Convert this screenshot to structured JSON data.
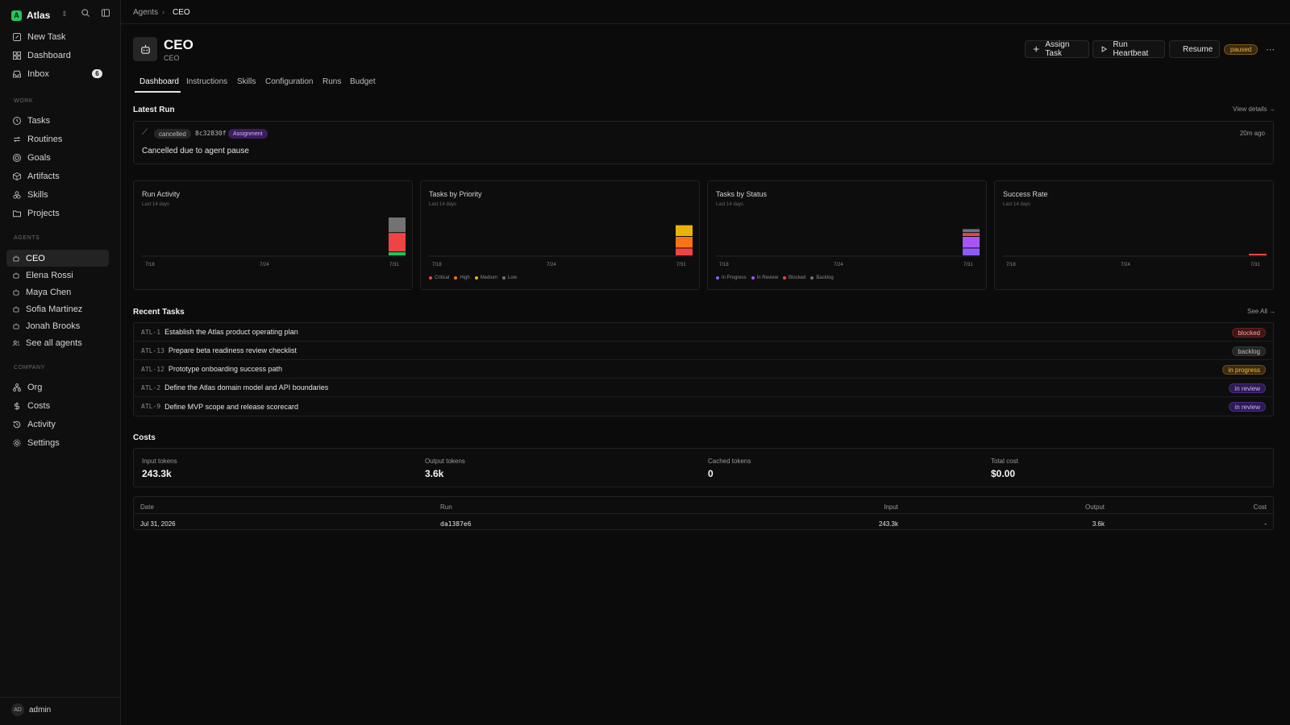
{
  "workspace": {
    "initial": "A",
    "name": "Atlas"
  },
  "sidebar": {
    "top": [
      {
        "label": "New Task",
        "icon": "edit-icon"
      },
      {
        "label": "Dashboard",
        "icon": "dashboard-icon"
      },
      {
        "label": "Inbox",
        "icon": "inbox-icon",
        "count": "6"
      }
    ],
    "work_label": "WORK",
    "work": [
      {
        "label": "Tasks",
        "icon": "circle-icon"
      },
      {
        "label": "Routines",
        "icon": "repeat-icon"
      },
      {
        "label": "Goals",
        "icon": "target-icon"
      },
      {
        "label": "Artifacts",
        "icon": "box-icon"
      },
      {
        "label": "Skills",
        "icon": "skills-icon"
      },
      {
        "label": "Projects",
        "icon": "folder-icon"
      }
    ],
    "agents_label": "AGENTS",
    "agents": [
      {
        "label": "CEO"
      },
      {
        "label": "Elena Rossi"
      },
      {
        "label": "Maya Chen"
      },
      {
        "label": "Sofia Martinez"
      },
      {
        "label": "Jonah Brooks"
      }
    ],
    "see_all_agents": "See all agents",
    "company_label": "COMPANY",
    "company": [
      {
        "label": "Org",
        "icon": "org-icon"
      },
      {
        "label": "Costs",
        "icon": "dollar-icon"
      },
      {
        "label": "Activity",
        "icon": "history-icon"
      },
      {
        "label": "Settings",
        "icon": "gear-icon"
      }
    ],
    "user": {
      "initials": "AD",
      "name": "admin"
    }
  },
  "breadcrumb": {
    "parent": "Agents",
    "current": "CEO"
  },
  "agent": {
    "name": "CEO",
    "role": "CEO",
    "status": "paused"
  },
  "actions": {
    "assign": "Assign Task",
    "heartbeat": "Run Heartbeat",
    "resume": "Resume"
  },
  "tabs": [
    "Dashboard",
    "Instructions",
    "Skills",
    "Configuration",
    "Runs",
    "Budget"
  ],
  "latest_run": {
    "heading": "Latest Run",
    "view_details": "View details →",
    "status": "cancelled",
    "id": "8c32830f",
    "tag": "Assignment",
    "time": "20m ago",
    "message": "Cancelled due to agent pause"
  },
  "charts": [
    {
      "title": "Run Activity",
      "subtitle": "Last 14 days",
      "chart_data": {
        "type": "bar",
        "categories": [
          "7/31"
        ],
        "series": [
          {
            "name": "",
            "color": "#22c55e",
            "values": [
              1
            ]
          },
          {
            "name": "",
            "color": "#ef4444",
            "values": [
              5
            ]
          },
          {
            "name": "",
            "color": "#737373",
            "values": [
              4
            ]
          }
        ]
      },
      "ticks": [
        "7/18",
        "7/24",
        "7/31"
      ],
      "legend": []
    },
    {
      "title": "Tasks by Priority",
      "subtitle": "Last 14 days",
      "chart_data": {
        "type": "bar",
        "categories": [
          "7/31"
        ],
        "series": [
          {
            "name": "Critical",
            "color": "#ef4444",
            "values": [
              2
            ]
          },
          {
            "name": "High",
            "color": "#f97316",
            "values": [
              3
            ]
          },
          {
            "name": "Medium",
            "color": "#eab308",
            "values": [
              3
            ]
          },
          {
            "name": "Low",
            "color": "#737373",
            "values": [
              0
            ]
          }
        ]
      },
      "ticks": [
        "7/18",
        "7/24",
        "7/31"
      ],
      "legend": [
        {
          "name": "Critical",
          "color": "#ef4444"
        },
        {
          "name": "High",
          "color": "#f97316"
        },
        {
          "name": "Medium",
          "color": "#eab308"
        },
        {
          "name": "Low",
          "color": "#737373"
        }
      ]
    },
    {
      "title": "Tasks by Status",
      "subtitle": "Last 14 days",
      "chart_data": {
        "type": "bar",
        "categories": [
          "7/31"
        ],
        "series": [
          {
            "name": "In Progress",
            "color": "#8b5cf6",
            "values": [
              2
            ]
          },
          {
            "name": "In Review",
            "color": "#a855f7",
            "values": [
              3
            ]
          },
          {
            "name": "Blocked",
            "color": "#ef4444",
            "values": [
              1
            ]
          },
          {
            "name": "Backlog",
            "color": "#64748b",
            "values": [
              1
            ]
          }
        ]
      },
      "ticks": [
        "7/18",
        "7/24",
        "7/31"
      ],
      "legend": [
        {
          "name": "In Progress",
          "color": "#8b5cf6"
        },
        {
          "name": "In Review",
          "color": "#a855f7"
        },
        {
          "name": "Blocked",
          "color": "#ef4444"
        },
        {
          "name": "Backlog",
          "color": "#64748b"
        }
      ]
    },
    {
      "title": "Success Rate",
      "subtitle": "Last 14 days",
      "chart_data": {
        "type": "bar",
        "categories": [
          "7/31"
        ],
        "series": [
          {
            "name": "",
            "color": "#ef4444",
            "values": [
              0
            ]
          }
        ]
      },
      "ticks": [
        "7/18",
        "7/24",
        "7/31"
      ],
      "legend": []
    }
  ],
  "recent_tasks": {
    "heading": "Recent Tasks",
    "see_all": "See All →",
    "rows": [
      {
        "id": "ATL-1",
        "title": "Establish the Atlas product operating plan",
        "status": "blocked"
      },
      {
        "id": "ATL-13",
        "title": "Prepare beta readiness review checklist",
        "status": "backlog"
      },
      {
        "id": "ATL-12",
        "title": "Prototype onboarding success path",
        "status": "in progress"
      },
      {
        "id": "ATL-2",
        "title": "Define the Atlas domain model and API boundaries",
        "status": "in review"
      },
      {
        "id": "ATL-9",
        "title": "Define MVP scope and release scorecard",
        "status": "in review"
      }
    ]
  },
  "costs": {
    "heading": "Costs",
    "summary": [
      {
        "label": "Input tokens",
        "value": "243.3k"
      },
      {
        "label": "Output tokens",
        "value": "3.6k"
      },
      {
        "label": "Cached tokens",
        "value": "0"
      },
      {
        "label": "Total cost",
        "value": "$0.00"
      }
    ],
    "table": {
      "headers": [
        "Date",
        "Run",
        "Input",
        "Output",
        "Cost"
      ],
      "rows": [
        [
          "Jul 31, 2026",
          "da1387e6",
          "243.3k",
          "3.6k",
          "-"
        ]
      ]
    }
  }
}
